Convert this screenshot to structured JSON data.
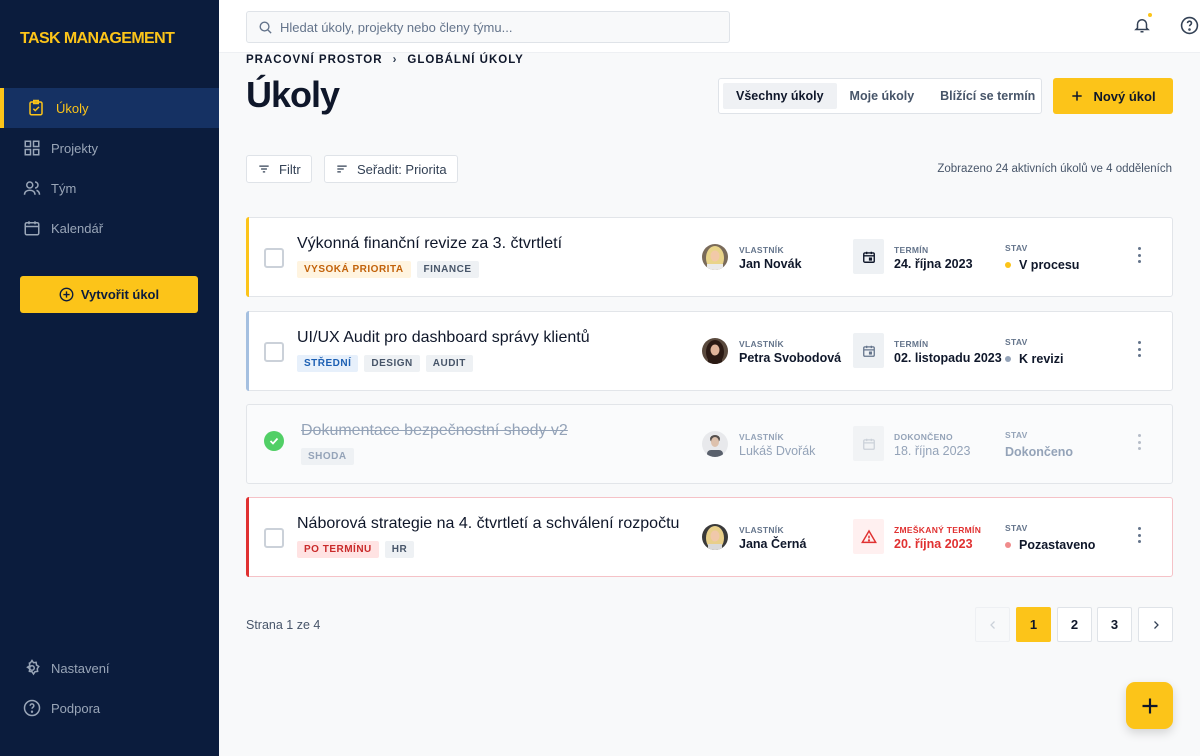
{
  "app": {
    "logo": "TASK MANAGEMENT"
  },
  "sidebar": {
    "items": [
      {
        "label": "Úkoly",
        "icon": "clipboard-check-icon",
        "active": true
      },
      {
        "label": "Projekty",
        "icon": "grid-icon"
      },
      {
        "label": "Tým",
        "icon": "users-icon"
      },
      {
        "label": "Kalendář",
        "icon": "calendar-icon"
      }
    ],
    "create_label": "Vytvořit úkol",
    "bottom": [
      {
        "label": "Nastavení",
        "icon": "gear-icon"
      },
      {
        "label": "Podpora",
        "icon": "help-circle-icon"
      }
    ]
  },
  "search": {
    "placeholder": "Hledat úkoly, projekty nebo členy týmu..."
  },
  "breadcrumb": [
    "PRACOVNÍ PROSTOR",
    "GLOBÁLNÍ ÚKOLY"
  ],
  "page": {
    "title": "Úkoly"
  },
  "tabs": [
    "Všechny úkoly",
    "Moje úkoly",
    "Blížící se termín"
  ],
  "new_task_label": "Nový úkol",
  "filters": {
    "filter_label": "Filtr",
    "sort_label": "Seřadit: Priorita"
  },
  "summary": "Zobrazeno 24 aktivních úkolů ve 4 odděleních",
  "tasks": [
    {
      "title": "Výkonná finanční revize za 3. čtvrtletí",
      "tags": [
        "VYSOKÁ PRIORITA",
        "FINANCE"
      ],
      "owner_label": "VLASTNÍK",
      "owner": "Jan Novák",
      "date_label": "TERMÍN",
      "date": "24. října 2023",
      "status_label": "STAV",
      "status": "V procesu"
    },
    {
      "title": "UI/UX Audit pro dashboard správy klientů",
      "tags": [
        "STŘEDNÍ",
        "DESIGN",
        "AUDIT"
      ],
      "owner_label": "VLASTNÍK",
      "owner": "Petra Svobodová",
      "date_label": "TERMÍN",
      "date": "02. listopadu 2023",
      "status_label": "STAV",
      "status": "K revizi"
    },
    {
      "title": "Dokumentace bezpečnostní shody v2",
      "tags": [
        "SHODA"
      ],
      "owner_label": "VLASTNÍK",
      "owner": "Lukáš Dvořák",
      "date_label": "DOKONČENO",
      "date": "18. října 2023",
      "status_label": "STAV",
      "status": "Dokončeno"
    },
    {
      "title": "Náborová strategie na 4. čtvrtletí a schválení rozpočtu",
      "tags": [
        "PO TERMÍNU",
        "HR"
      ],
      "owner_label": "VLASTNÍK",
      "owner": "Jana Černá",
      "date_label": "ZMEŠKANÝ TERMÍN",
      "date": "20. října 2023",
      "status_label": "STAV",
      "status": "Pozastaveno"
    }
  ],
  "pagination": {
    "info": "Strana 1 ze 4",
    "pages": [
      "1",
      "2",
      "3"
    ]
  },
  "colors": {
    "accent": "#fcc419",
    "sidebar": "#0b1c3d",
    "danger": "#e03131",
    "medium": "#a5c0e0"
  }
}
